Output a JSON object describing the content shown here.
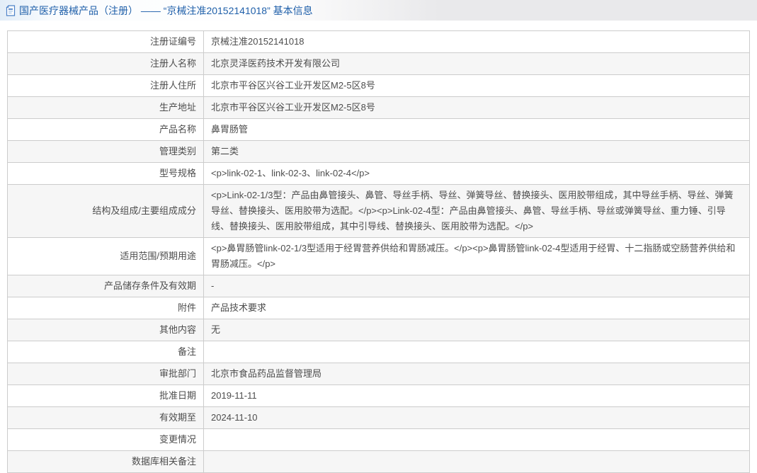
{
  "header": {
    "icon": "document-icon",
    "title": "国产医疗器械产品（注册） —— “京械注准20152141018” 基本信息"
  },
  "table": {
    "rows": [
      {
        "label": "注册证编号",
        "value": "京械注准20152141018"
      },
      {
        "label": "注册人名称",
        "value": "北京灵泽医药技术开发有限公司"
      },
      {
        "label": "注册人住所",
        "value": "北京市平谷区兴谷工业开发区M2-5区8号"
      },
      {
        "label": "生产地址",
        "value": "北京市平谷区兴谷工业开发区M2-5区8号"
      },
      {
        "label": "产品名称",
        "value": "鼻胃肠管"
      },
      {
        "label": "管理类别",
        "value": "第二类"
      },
      {
        "label": "型号规格",
        "value": "<p>link-02-1、link-02-3、link-02-4</p>"
      },
      {
        "label": "结构及组成/主要组成成分",
        "value": "<p>Link-02-1/3型：产品由鼻管接头、鼻管、导丝手柄、导丝、弹簧导丝、替换接头、医用胶带组成，其中导丝手柄、导丝、弹簧导丝、替换接头、医用胶带为选配。</p><p>Link-02-4型：产品由鼻管接头、鼻管、导丝手柄、导丝或弹簧导丝、重力锤、引导线、替换接头、医用胶带组成，其中引导线、替换接头、医用胶带为选配。</p>"
      },
      {
        "label": "适用范围/预期用途",
        "value": "<p>鼻胃肠管link-02-1/3型适用于经胃营养供给和胃肠减压。</p><p>鼻胃肠管link-02-4型适用于经胃、十二指肠或空肠营养供给和胃肠减压。</p>"
      },
      {
        "label": "产品储存条件及有效期",
        "value": "-"
      },
      {
        "label": "附件",
        "value": "产品技术要求"
      },
      {
        "label": "其他内容",
        "value": "无"
      },
      {
        "label": "备注",
        "value": ""
      },
      {
        "label": "审批部门",
        "value": "北京市食品药品监督管理局"
      },
      {
        "label": "批准日期",
        "value": "2019-11-11"
      },
      {
        "label": "有效期至",
        "value": "2024-11-10"
      },
      {
        "label": "变更情况",
        "value": ""
      },
      {
        "label": "数据库相关备注",
        "value": ""
      }
    ]
  },
  "colors": {
    "title_blue": "#2060aa",
    "header_bar_gray": "#e9e9eb",
    "header_bar_blue_tint": "#e2edf8",
    "table_border": "#cccccc",
    "row_stripe": "#f6f6f6",
    "cell_text": "#4d4d4d",
    "page_background": "#ffffff"
  }
}
